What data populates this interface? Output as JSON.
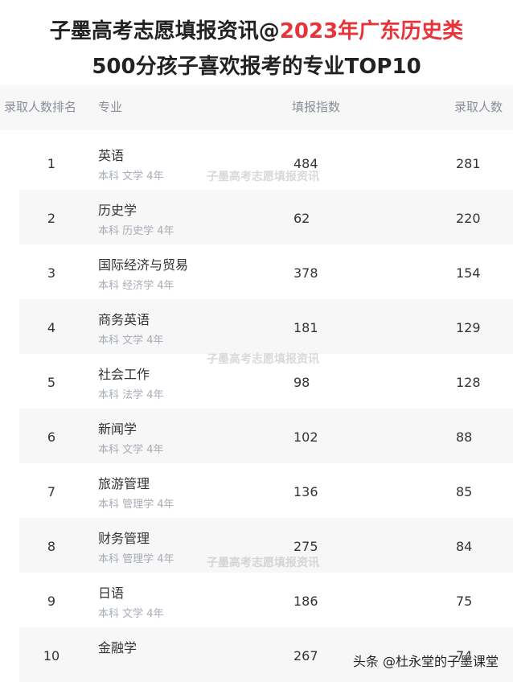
{
  "title": {
    "line1_prefix": "子墨高考志愿填报资讯@",
    "line1_highlight": "2023年广东历史类",
    "line2": "500分孩子喜欢报考的专业TOP10",
    "highlight_color": "#e8333a"
  },
  "table": {
    "headers": {
      "rank": "录取人数排名",
      "major": "专业",
      "index": "填报指数",
      "admit": "录取人数"
    },
    "rows": [
      {
        "rank": "1",
        "major": "英语",
        "sub": "本科 文学 4年",
        "index": "484",
        "admit": "281"
      },
      {
        "rank": "2",
        "major": "历史学",
        "sub": "本科 历史学 4年",
        "index": "62",
        "admit": "220"
      },
      {
        "rank": "3",
        "major": "国际经济与贸易",
        "sub": "本科 经济学 4年",
        "index": "378",
        "admit": "154"
      },
      {
        "rank": "4",
        "major": "商务英语",
        "sub": "本科 文学 4年",
        "index": "181",
        "admit": "129"
      },
      {
        "rank": "5",
        "major": "社会工作",
        "sub": "本科 法学 4年",
        "index": "98",
        "admit": "128"
      },
      {
        "rank": "6",
        "major": "新闻学",
        "sub": "本科 文学 4年",
        "index": "102",
        "admit": "88"
      },
      {
        "rank": "7",
        "major": "旅游管理",
        "sub": "本科 管理学 4年",
        "index": "136",
        "admit": "85"
      },
      {
        "rank": "8",
        "major": "财务管理",
        "sub": "本科 管理学 4年",
        "index": "275",
        "admit": "84"
      },
      {
        "rank": "9",
        "major": "日语",
        "sub": "本科 文学 4年",
        "index": "186",
        "admit": "75"
      },
      {
        "rank": "10",
        "major": "金融学",
        "sub": "",
        "index": "267",
        "admit": "74"
      }
    ]
  },
  "watermark": "子墨高考志愿填报资讯",
  "footer": "头条 @杜永堂的子墨课堂"
}
